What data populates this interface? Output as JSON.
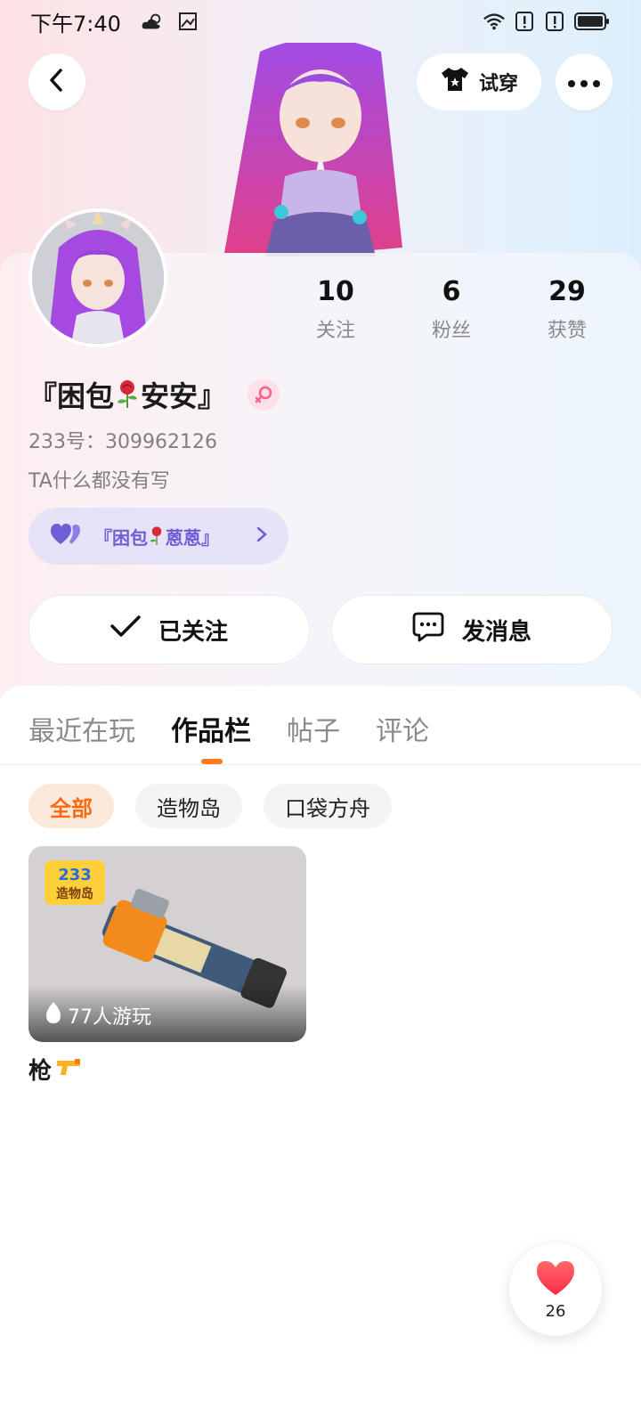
{
  "status_bar": {
    "time": "下午7:40",
    "icons_left": [
      "weather-cloudy-icon",
      "gallery-icon"
    ],
    "icons_right": [
      "wifi-icon",
      "alert-icon",
      "alert-icon",
      "battery-icon"
    ]
  },
  "header": {
    "back_icon": "chevron-left-icon",
    "try_on_label": "试穿",
    "more_icon": "more-horizontal-icon"
  },
  "profile": {
    "stats": [
      {
        "value": "10",
        "label": "关注"
      },
      {
        "value": "6",
        "label": "粉丝"
      },
      {
        "value": "29",
        "label": "获赞"
      }
    ],
    "nickname_prefix": "『困包",
    "nickname_suffix": "安安』",
    "gender": "female",
    "uid": "233号：309962126",
    "bio": "TA什么都没有写",
    "cp_chip": {
      "name_prefix": "『困包",
      "name_suffix": "蒽蒽』"
    },
    "buttons": {
      "followed_label": "已关注",
      "message_label": "发消息"
    }
  },
  "tabs": [
    {
      "label": "最近在玩",
      "active": false
    },
    {
      "label": "作品栏",
      "active": true
    },
    {
      "label": "帖子",
      "active": false
    },
    {
      "label": "评论",
      "active": false
    }
  ],
  "filters": [
    {
      "label": "全部",
      "active": true
    },
    {
      "label": "造物岛",
      "active": false
    },
    {
      "label": "口袋方舟",
      "active": false
    }
  ],
  "works": [
    {
      "title": "枪",
      "play_count": "77人游玩",
      "badge_text": "233",
      "badge_sub": "造物岛"
    }
  ],
  "like_fab": {
    "count": "26"
  },
  "colors": {
    "accent_orange": "#ff7a1a",
    "cp_purple": "#6f5fd6",
    "like_red": "#ff3b4e"
  }
}
